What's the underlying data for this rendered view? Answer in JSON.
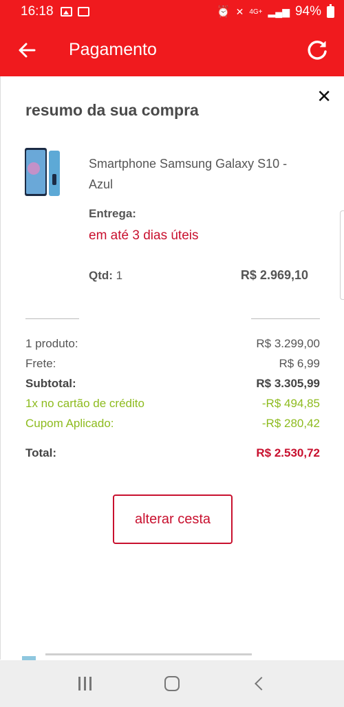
{
  "status_bar": {
    "time": "16:18",
    "network": "4G+",
    "battery": "94%"
  },
  "app_bar": {
    "title": "Pagamento"
  },
  "summary_sheet": {
    "heading": "resumo da sua compra",
    "product": {
      "name": "Smartphone Samsung Galaxy S10 - Azul",
      "delivery_label": "Entrega:",
      "delivery_value": "em até 3 dias úteis",
      "qty_label": "Qtd:",
      "qty_value": "1",
      "price": "R$ 2.969,10"
    },
    "rows": [
      {
        "label": "1 produto:",
        "value": "R$ 3.299,00"
      },
      {
        "label": "Frete:",
        "value": "R$ 6,99"
      },
      {
        "label": "Subtotal:",
        "value": "R$ 3.305,99"
      },
      {
        "label": "1x no cartão de crédito",
        "value": "-R$ 494,85"
      },
      {
        "label": "Cupom Aplicado:",
        "value": "-R$ 280,42"
      }
    ],
    "total": {
      "label": "Total:",
      "value": "R$ 2.530,72"
    },
    "change_cart_button": "alterar cesta"
  },
  "colors": {
    "brand_red": "#f01a1e",
    "accent_red": "#c8102e",
    "discount_green": "#8dbb1e"
  }
}
